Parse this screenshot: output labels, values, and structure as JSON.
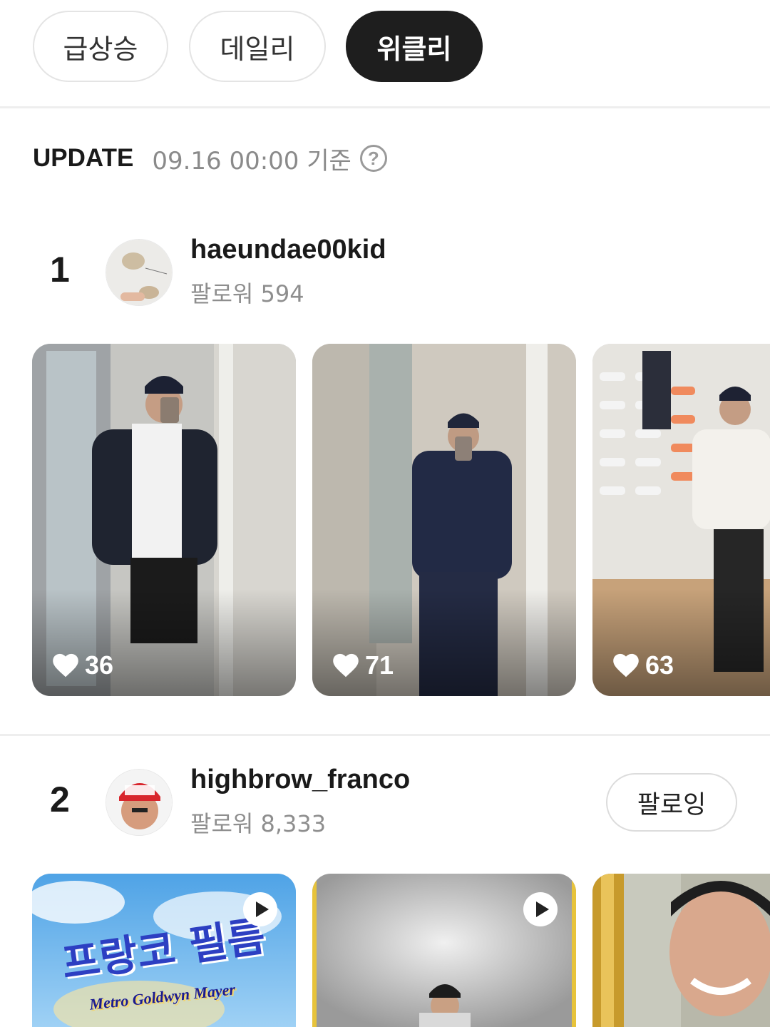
{
  "tabs": [
    {
      "label": "급상승",
      "active": false
    },
    {
      "label": "데일리",
      "active": false
    },
    {
      "label": "위클리",
      "active": true
    }
  ],
  "update": {
    "label": "UPDATE",
    "time": "09.16 00:00 기준",
    "help_icon": "question-circle-icon"
  },
  "rankings": [
    {
      "rank": "1",
      "username": "haeundae00kid",
      "followers": "팔로워 594",
      "posts": [
        {
          "likes": "36",
          "type": "photo"
        },
        {
          "likes": "71",
          "type": "photo"
        },
        {
          "likes": "63",
          "type": "photo"
        }
      ]
    },
    {
      "rank": "2",
      "username": "highbrow_franco",
      "followers": "팔로워 8,333",
      "follow_button": "팔로잉",
      "posts": [
        {
          "type": "video",
          "overlay_text": "프랑코 필름",
          "overlay_subtext": "Metro Goldwyn Mayer"
        },
        {
          "type": "video"
        },
        {
          "type": "photo"
        }
      ]
    }
  ],
  "colors": {
    "active_tab": "#1e1e1e",
    "muted_text": "#8e8e8e",
    "divider": "#eeeeee"
  }
}
